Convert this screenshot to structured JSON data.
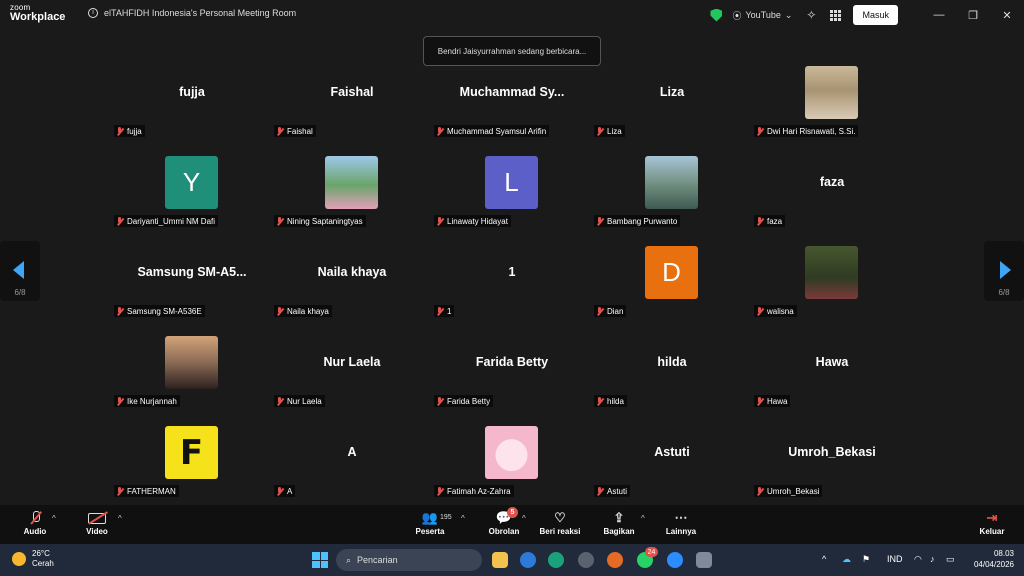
{
  "titlebar": {
    "logo_top": "zoom",
    "logo_bottom": "Workplace",
    "meeting_title": "elTAHFIDH Indonesia's Personal Meeting Room",
    "share_source": "YouTube",
    "sign_in_label": "Masuk",
    "shield_color": "#22c55e"
  },
  "speaking_banner": "Bendri Jaisyurrahman sedang berbicara...",
  "pagination": {
    "left": "6/8",
    "right": "6/8",
    "arrow_color": "#3ea6f5"
  },
  "participants": [
    {
      "display": "fujja",
      "label": "fujja",
      "kind": "name"
    },
    {
      "display": "Faishal",
      "label": "Faishal",
      "kind": "name"
    },
    {
      "display": "Muchammad  Sy...",
      "label": "Muchammad Syamsul Arifin",
      "kind": "name"
    },
    {
      "display": "Liza",
      "label": "Liza",
      "kind": "name"
    },
    {
      "display": "",
      "label": "Dwi Hari Risnawati, S.Si.",
      "kind": "photo"
    },
    {
      "display": "Y",
      "label": "Dariyanti_Ummi NM Dafi",
      "kind": "letter",
      "color": "#1f8f7a"
    },
    {
      "display": "",
      "label": "Nining Saptaningtyas",
      "kind": "photo"
    },
    {
      "display": "L",
      "label": "Linawaty Hidayat",
      "kind": "letter",
      "color": "#5b5fc7"
    },
    {
      "display": "",
      "label": "Bambang Purwanto",
      "kind": "photo"
    },
    {
      "display": "faza",
      "label": "faza",
      "kind": "name"
    },
    {
      "display": "Samsung  SM-A5...",
      "label": "Samsung SM-A536E",
      "kind": "name"
    },
    {
      "display": "Naila khaya",
      "label": "Naila khaya",
      "kind": "name"
    },
    {
      "display": "1",
      "label": "1",
      "kind": "name"
    },
    {
      "display": "D",
      "label": "Dian",
      "kind": "letter",
      "color": "#e8700f"
    },
    {
      "display": "",
      "label": "walisna",
      "kind": "photo"
    },
    {
      "display": "",
      "label": "Ike Nurjannah",
      "kind": "photo"
    },
    {
      "display": "Nur Laela",
      "label": "Nur Laela",
      "kind": "name"
    },
    {
      "display": "Farida Betty",
      "label": "Farida Betty",
      "kind": "name"
    },
    {
      "display": "hilda",
      "label": "hilda",
      "kind": "name"
    },
    {
      "display": "Hawa",
      "label": "Hawa",
      "kind": "name"
    },
    {
      "display": "F",
      "label": "FATHERMAN",
      "kind": "logo"
    },
    {
      "display": "A",
      "label": "A",
      "kind": "name"
    },
    {
      "display": "",
      "label": "Fatimah Az-Zahra",
      "kind": "photo"
    },
    {
      "display": "Astuti",
      "label": "Astuti",
      "kind": "name"
    },
    {
      "display": "Umroh_Bekasi",
      "label": "Umroh_Bekasi",
      "kind": "name"
    }
  ],
  "toolbar": {
    "audio": "Audio",
    "video": "Video",
    "participants": "Peserta",
    "participants_count": "195",
    "chat": "Obrolan",
    "chat_badge": "5",
    "react": "Beri reaksi",
    "share": "Bagikan",
    "more": "Lainnya",
    "leave": "Keluar"
  },
  "taskbar": {
    "temperature": "26°C",
    "weather": "Cerah",
    "search_placeholder": "Pencarian",
    "whatsapp_badge": "24",
    "language": "IND",
    "time": "08.03",
    "date": "04/04/2026"
  }
}
